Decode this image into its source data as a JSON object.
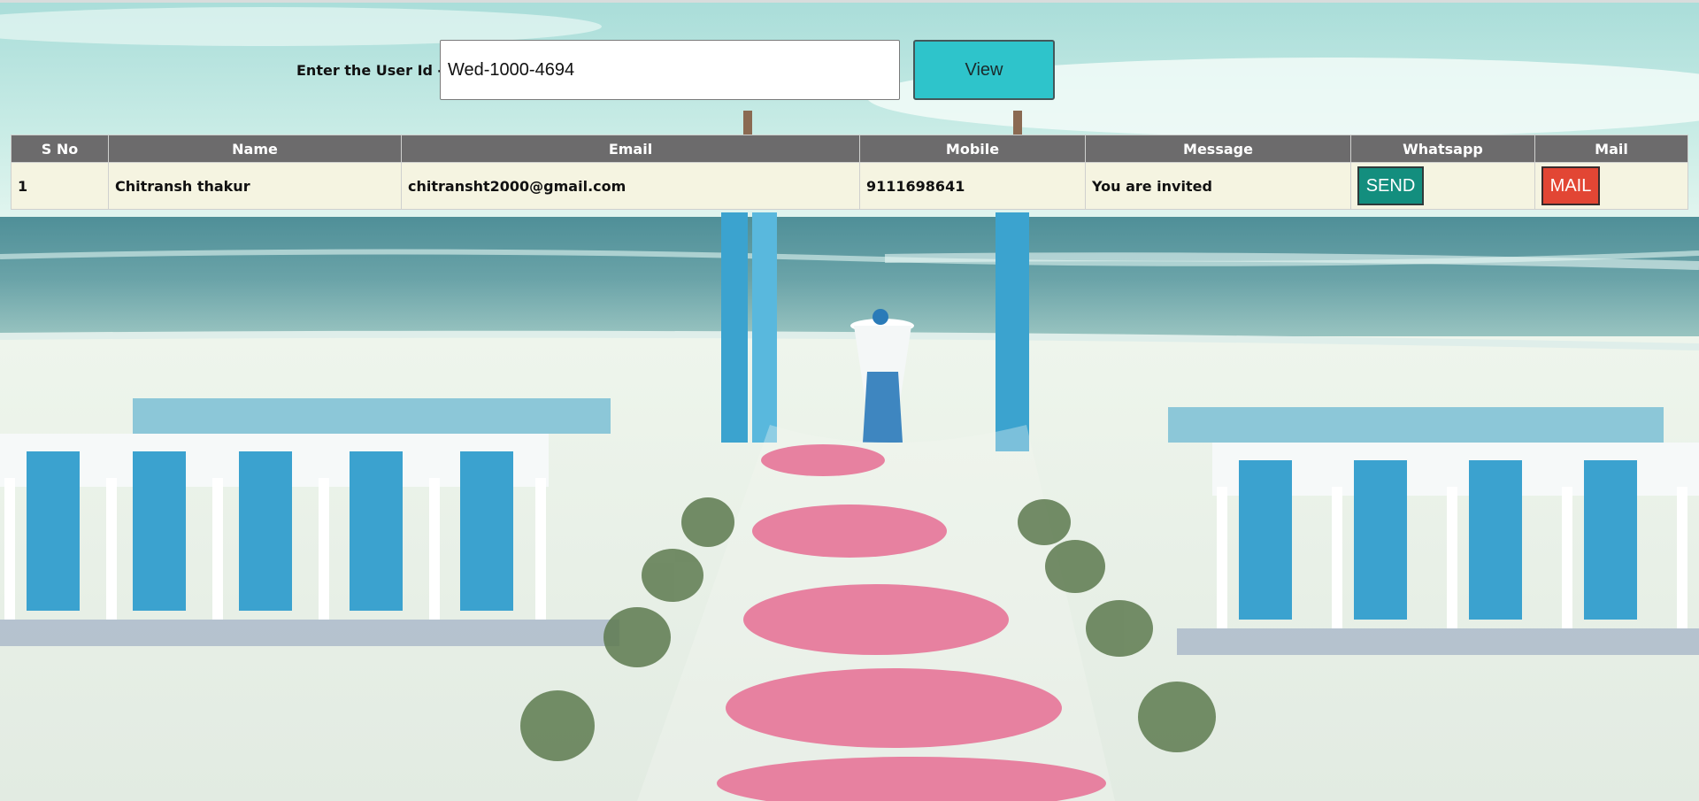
{
  "search": {
    "label": "Enter the User Id -",
    "value": "Wed-1000-4694",
    "button_label": "View"
  },
  "table": {
    "headers": [
      "S No",
      "Name",
      "Email",
      "Mobile",
      "Message",
      "Whatsapp",
      "Mail"
    ],
    "rows": [
      {
        "sno": "1",
        "name": "Chitransh thakur",
        "email": "chitransht2000@gmail.com",
        "mobile": "9111698641",
        "message": "You are invited",
        "whatsapp_button": "SEND",
        "mail_button": "MAIL"
      }
    ]
  },
  "colors": {
    "view_button": "#2ec4cb",
    "table_header": "#6c6b6c",
    "table_row": "#f5f4e1",
    "send_button": "#138e7e",
    "mail_button": "#e24634"
  }
}
